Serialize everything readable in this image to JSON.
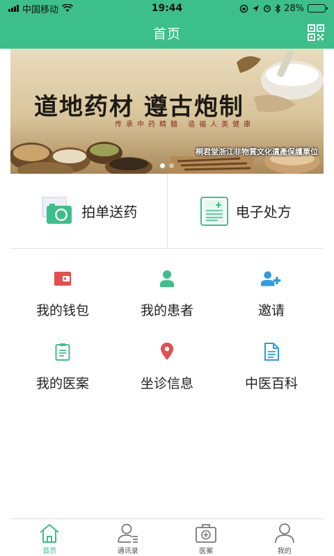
{
  "status_bar": {
    "carrier": "中国移动",
    "time": "19:44",
    "battery": "28%",
    "battery_level": 0.28
  },
  "header": {
    "title": "首页"
  },
  "banner": {
    "title": "道地药材  遵古炮制",
    "subtitle": "传承中药精髓 造福人类健康",
    "org": "桐君堂浙江非物質文化遺產保護單位",
    "slide_count": 2,
    "active_slide": 1
  },
  "primary_actions": [
    {
      "label": "拍单送药",
      "icon": "camera-photo-icon"
    },
    {
      "label": "电子处方",
      "icon": "prescription-icon"
    }
  ],
  "features": [
    {
      "label": "我的钱包",
      "icon": "wallet-icon",
      "color": "#e64d4d"
    },
    {
      "label": "我的患者",
      "icon": "patient-icon",
      "color": "#3cbf8a"
    },
    {
      "label": "邀请",
      "icon": "add-user-icon",
      "color": "#2f9be3"
    },
    {
      "label": "我的医案",
      "icon": "clipboard-icon",
      "color": "#3cbf8a"
    },
    {
      "label": "坐诊信息",
      "icon": "location-pin-icon",
      "color": "#e64d4d"
    },
    {
      "label": "中医百科",
      "icon": "document-icon",
      "color": "#2f9be3"
    }
  ],
  "tabs": [
    {
      "label": "首页",
      "icon": "home-icon",
      "active": true
    },
    {
      "label": "通讯录",
      "icon": "contacts-icon",
      "active": false
    },
    {
      "label": "医案",
      "icon": "medical-kit-icon",
      "active": false
    },
    {
      "label": "我的",
      "icon": "profile-icon",
      "active": false
    }
  ],
  "colors": {
    "primary": "#3cbf8a",
    "red": "#e64d4d",
    "blue": "#2f9be3"
  }
}
